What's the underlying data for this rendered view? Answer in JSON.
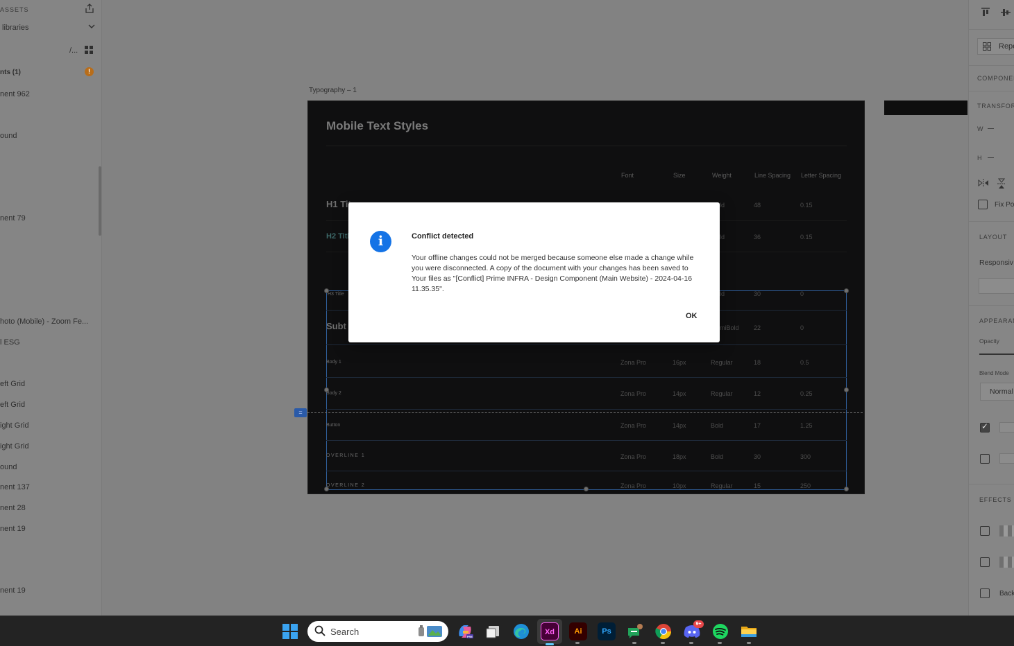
{
  "left_panel": {
    "header": "ASSETS",
    "libraries_dropdown": "libraries",
    "path_indicator": "/...",
    "items": [
      "nts (1)",
      "nent 962",
      "ound",
      "nent 79",
      "hoto (Mobile) - Zoom Fe...",
      "l ESG",
      "eft Grid",
      "eft Grid",
      "ight Grid",
      "ight Grid",
      "ound",
      "nent 137",
      "nent 28",
      "nent 19",
      "nent 19"
    ],
    "warning_glyph": "!"
  },
  "canvas": {
    "artboard_label": "Typography – 1",
    "artboard_title": "Mobile Text Styles",
    "column_headers": [
      "Font",
      "Size",
      "Weight",
      "Line Spacing",
      "Letter Spacing"
    ],
    "rows": [
      {
        "sample": "H1 Tit",
        "font": "",
        "size": "",
        "weight": "ld",
        "line": "48",
        "letter": "0.15"
      },
      {
        "sample": "H2 Titl",
        "font": "",
        "size": "",
        "weight": "ld",
        "line": "36",
        "letter": "0.15"
      },
      {
        "sample": "H3 Title",
        "font": "",
        "size": "",
        "weight": "ld",
        "line": "30",
        "letter": "0"
      },
      {
        "sample": "Subt",
        "font": "",
        "size": "",
        "weight": "miBold",
        "line": "22",
        "letter": "0"
      },
      {
        "sample": "Body 1",
        "font": "Zona Pro",
        "size": "16px",
        "weight": "Regular",
        "line": "18",
        "letter": "0.5"
      },
      {
        "sample": "Body 2",
        "font": "Zona Pro",
        "size": "14px",
        "weight": "Regular",
        "line": "12",
        "letter": "0.25"
      },
      {
        "sample": "Button",
        "font": "Zona Pro",
        "size": "14px",
        "weight": "Bold",
        "line": "17",
        "letter": "1.25"
      },
      {
        "sample": "OVERLINE 1",
        "font": "Zona Pro",
        "size": "18px",
        "weight": "Bold",
        "line": "30",
        "letter": "300"
      },
      {
        "sample": "OVERLINE 2",
        "font": "Zona Pro",
        "size": "10px",
        "weight": "Regular",
        "line": "15",
        "letter": "250"
      }
    ],
    "guide_tag": "="
  },
  "right_panel": {
    "repeat_grid": "Repe",
    "component_header": "COMPONEN",
    "transform_header": "TRANSFOR",
    "w_label": "W",
    "h_label": "H",
    "fix_position": "Fix Po",
    "layout_header": "LAYOUT",
    "responsive_resize": "Responsiv",
    "appearance_header": "APPEARAN",
    "opacity_label": "Opacity",
    "blend_mode_label": "Blend Mode",
    "blend_mode_value": "Normal",
    "effects_header": "EFFECTS",
    "background_blur": "Back"
  },
  "dialog": {
    "title": "Conflict detected",
    "body": "Your offline changes could not be merged because someone else made a change while you were disconnected. A copy of the document with your changes has been saved to Your files as \"[Conflict] Prime INFRA - Design Component (Main Website) - 2024-04-16 11.35.35\".",
    "ok_label": "OK",
    "icon": "info-icon",
    "accent_color": "#1473e6"
  },
  "taskbar": {
    "search_placeholder": "Search",
    "apps": [
      {
        "name": "copilot",
        "label": ""
      },
      {
        "name": "task-view",
        "label": ""
      },
      {
        "name": "edge",
        "label": ""
      },
      {
        "name": "adobe-xd",
        "label": "Xd"
      },
      {
        "name": "illustrator",
        "label": "Ai"
      },
      {
        "name": "photoshop",
        "label": "Ps"
      },
      {
        "name": "messaging",
        "label": ""
      },
      {
        "name": "chrome",
        "label": ""
      },
      {
        "name": "discord",
        "label": "",
        "badge": "9+"
      },
      {
        "name": "spotify",
        "label": ""
      },
      {
        "name": "file-explorer",
        "label": ""
      }
    ]
  }
}
